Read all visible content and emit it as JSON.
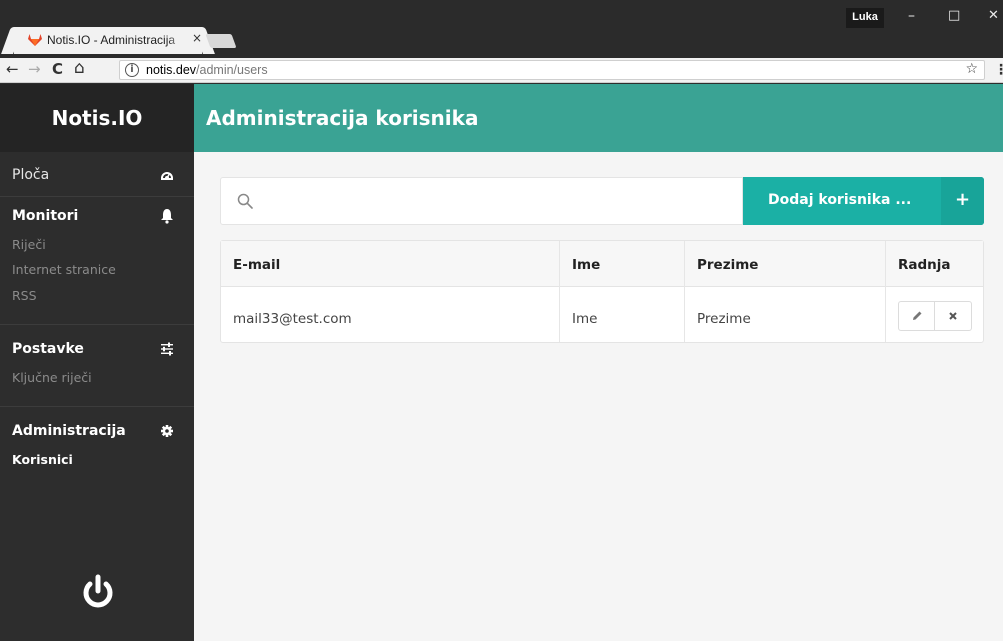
{
  "browser": {
    "tab_title": "Notis.IO - Administracija",
    "tab_close": "×",
    "url_host": "notis.dev",
    "url_path": "/admin/users",
    "profile_name": "Luka",
    "window_buttons": {
      "minimize": "–",
      "maximize": "□",
      "close": "✕"
    },
    "nav": {
      "back": "←",
      "forward": "→",
      "reload": "C",
      "home": "⌂",
      "star": "☆",
      "menu": "⋮",
      "info": "i"
    }
  },
  "sidebar": {
    "brand": "Notis.IO",
    "items": [
      {
        "label": "Ploča",
        "icon": "dashboard-icon",
        "bold": false
      },
      {
        "label": "Monitori",
        "icon": "bell-icon",
        "bold": true,
        "children": [
          "Riječi",
          "Internet stranice",
          "RSS"
        ]
      },
      {
        "label": "Postavke",
        "icon": "sliders-icon",
        "bold": true,
        "children": [
          "Ključne riječi"
        ]
      },
      {
        "label": "Administracija",
        "icon": "gear-icon",
        "bold": true,
        "children": [
          "Korisnici"
        ]
      }
    ],
    "active_child": "Korisnici",
    "power_icon": "power-icon"
  },
  "main": {
    "title": "Administracija korisnika",
    "search": {
      "placeholder": "",
      "value": ""
    },
    "add_button_label": "Dodaj korisnika ...",
    "add_button_icon": "+",
    "table": {
      "columns": [
        "E-mail",
        "Ime",
        "Prezime",
        "Radnja"
      ],
      "rows": [
        {
          "email": "mail33@test.com",
          "ime": "Ime",
          "prezime": "Prezime"
        }
      ]
    }
  },
  "colors": {
    "header": "#3aa394",
    "accent_button": "#1bb0a5",
    "sidebar": "#2d2d2d"
  }
}
